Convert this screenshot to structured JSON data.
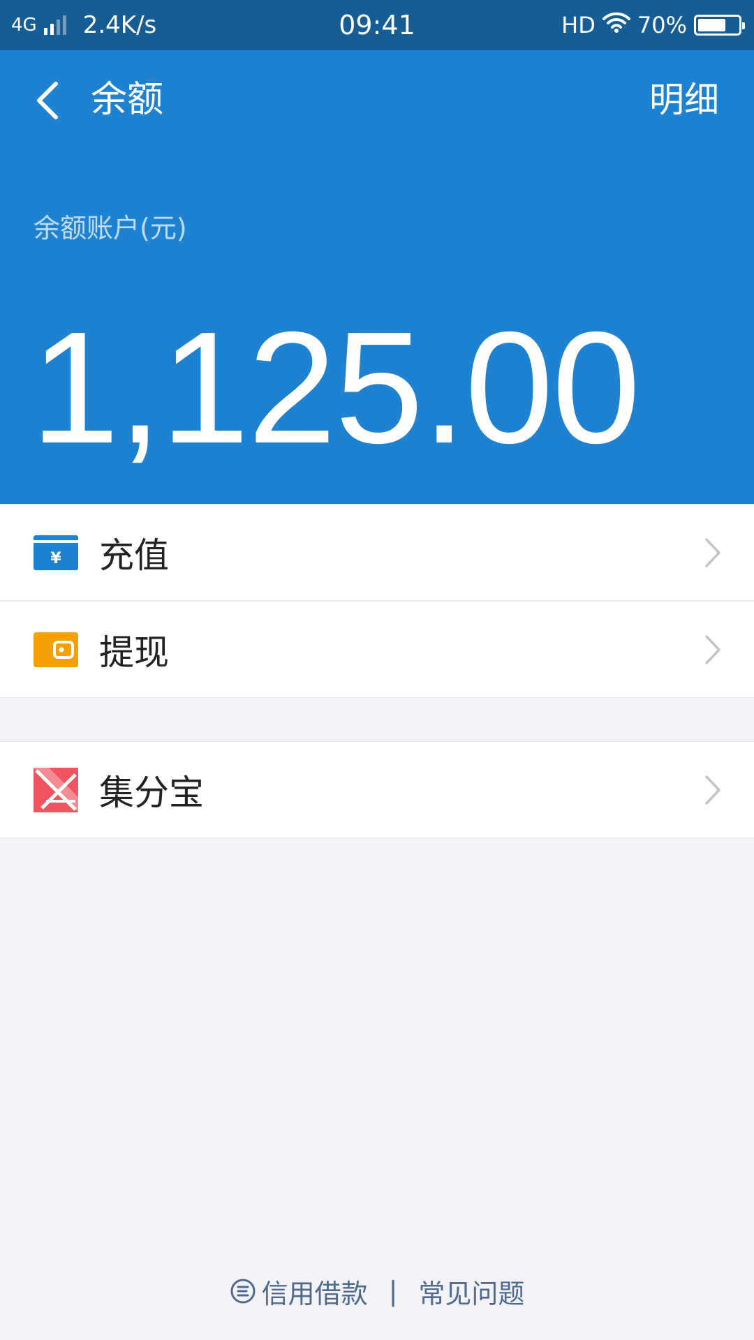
{
  "status_bar": {
    "network": "4G",
    "speed": "2.4K/s",
    "time": "09:41",
    "hd": "HD",
    "battery_text": "70%",
    "battery_level": 0.7
  },
  "nav": {
    "title": "余额",
    "detail": "明细"
  },
  "balance": {
    "label": "余额账户(元)",
    "amount": "1,125.00"
  },
  "menu": [
    {
      "label": "充值",
      "icon": "recharge-card-icon",
      "icon_color": "#1e82d3"
    },
    {
      "label": "提现",
      "icon": "wallet-icon",
      "icon_color": "#f5a106"
    },
    {
      "label": "集分宝",
      "icon": "jifenbao-icon",
      "icon_color": "#f0545f"
    }
  ],
  "footer": {
    "credit_loan": "信用借款",
    "separator": "|",
    "faq": "常见问题"
  },
  "colors": {
    "header_bg": "#1e82d3",
    "status_bg": "#165d95",
    "page_bg": "#f3f3f7"
  }
}
